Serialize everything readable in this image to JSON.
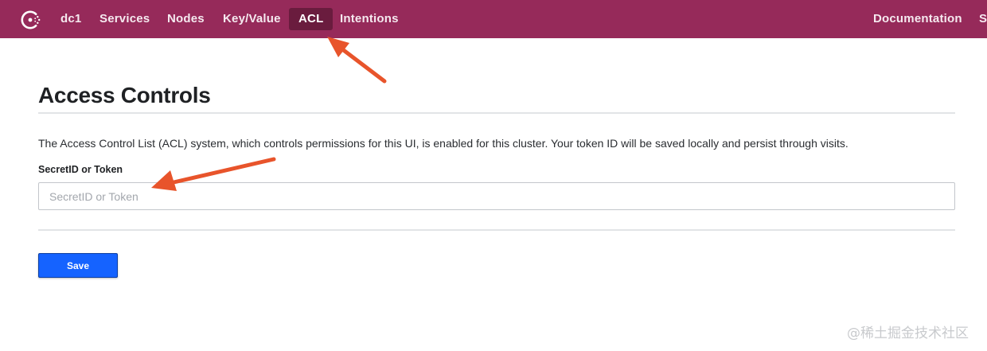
{
  "nav": {
    "datacenter": "dc1",
    "items": [
      {
        "label": "Services"
      },
      {
        "label": "Nodes"
      },
      {
        "label": "Key/Value"
      },
      {
        "label": "ACL",
        "active": true
      },
      {
        "label": "Intentions"
      }
    ],
    "right_items": [
      {
        "label": "Documentation"
      },
      {
        "label": "Settings"
      }
    ],
    "background_color": "#962a5a",
    "active_background_color": "#6a1c3e"
  },
  "main": {
    "title": "Access Controls",
    "description": "The Access Control List (ACL) system, which controls permissions for this UI, is enabled for this cluster. Your token ID will be saved locally and persist through visits.",
    "field_label": "SecretID or Token",
    "input_placeholder": "SecretID or Token",
    "input_value": "",
    "save_label": "Save",
    "button_color": "#1563ff"
  },
  "annotations": {
    "arrow_color": "#e8542b",
    "targets": [
      "ACL",
      "SecretID or Token"
    ]
  },
  "watermark": "@稀土掘金技术社区"
}
